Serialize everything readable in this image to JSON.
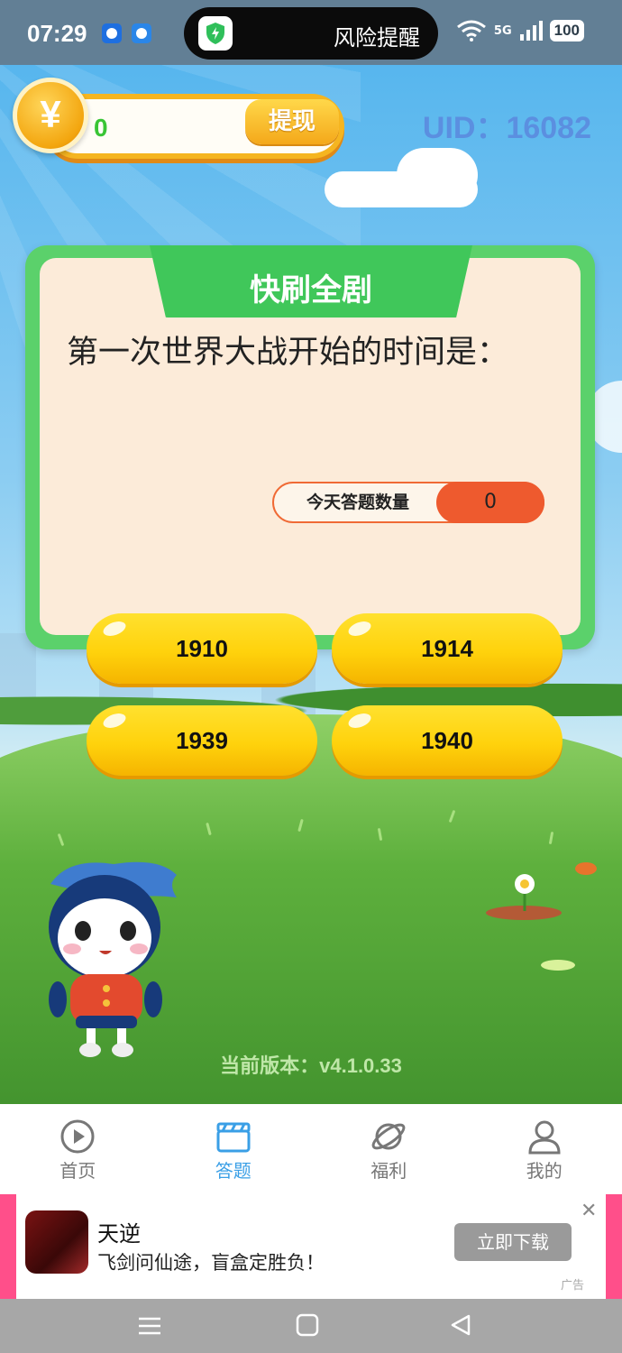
{
  "status_bar": {
    "time": "07:29",
    "island_text": "风险提醒",
    "network": "5G",
    "battery": "100"
  },
  "header": {
    "coin_value": "0",
    "withdraw_label": "提现",
    "uid": "UID：16082"
  },
  "quiz": {
    "card_title": "快刷全剧",
    "question": "第一次世界大战开始的时间是：",
    "count_label": "今天答题数量",
    "count_value": "0",
    "answers": [
      "1910",
      "1914",
      "1939",
      "1940"
    ]
  },
  "version_text": "当前版本：v4.1.0.33",
  "tabs": [
    {
      "label": "首页",
      "icon": "play-circle-icon",
      "active": false
    },
    {
      "label": "答题",
      "icon": "clapperboard-icon",
      "active": true
    },
    {
      "label": "福利",
      "icon": "planet-icon",
      "active": false
    },
    {
      "label": "我的",
      "icon": "user-icon",
      "active": false
    }
  ],
  "ad": {
    "title": "天逆",
    "subtitle": "飞剑问仙途，盲盒定胜负！",
    "button": "立即下载",
    "tag": "广告"
  },
  "colors": {
    "card_green": "#5bd16b",
    "answer_yellow": "#ffd20c",
    "count_orange": "#ee5a2e",
    "active_tab": "#3a9fe6",
    "uid_blue": "#5b8fe0"
  }
}
